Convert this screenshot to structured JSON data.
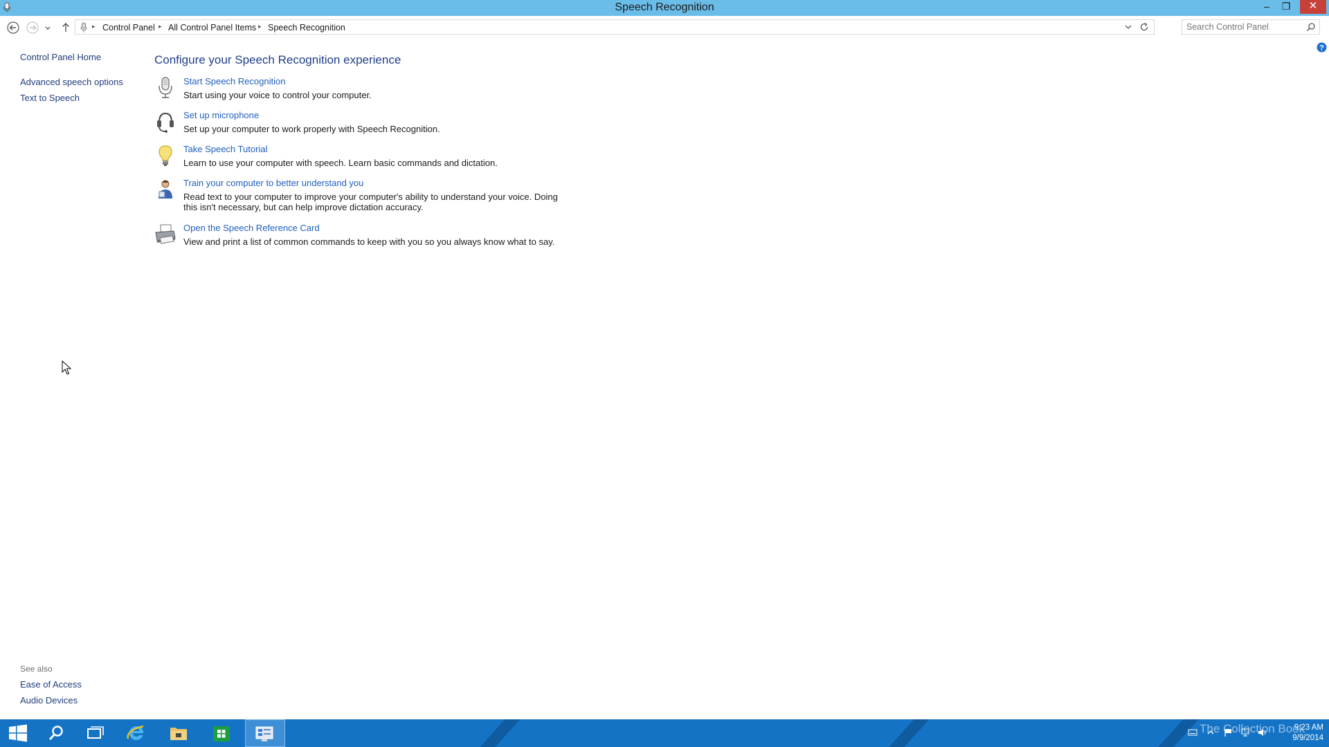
{
  "window": {
    "title": "Speech Recognition",
    "minimize_symbol": "–",
    "maximize_symbol": "❐",
    "close_symbol": "✕"
  },
  "address_bar": {
    "crumbs": [
      "Control Panel",
      "All Control Panel Items",
      "Speech Recognition"
    ],
    "separator": "▸"
  },
  "search": {
    "placeholder": "Search Control Panel"
  },
  "left_nav": {
    "home": "Control Panel Home",
    "items": [
      "Advanced speech options",
      "Text to Speech"
    ]
  },
  "see_also": {
    "label": "See also",
    "items": [
      "Ease of Access",
      "Audio Devices"
    ]
  },
  "main": {
    "heading": "Configure your Speech Recognition experience",
    "tasks": [
      {
        "icon": "microphone-icon",
        "link": "Start Speech Recognition",
        "desc": "Start using your voice to control your computer."
      },
      {
        "icon": "headset-icon",
        "link": "Set up microphone",
        "desc": "Set up your computer to work properly with Speech Recognition."
      },
      {
        "icon": "lightbulb-icon",
        "link": "Take Speech Tutorial",
        "desc": "Learn to use your computer with speech.  Learn basic commands and dictation."
      },
      {
        "icon": "user-train-icon",
        "link": "Train your computer to better understand you",
        "desc": "Read text to your computer to improve your computer's ability to understand your voice.  Doing this isn't necessary, but can help improve dictation accuracy."
      },
      {
        "icon": "printer-icon",
        "link": "Open the Speech Reference Card",
        "desc": "View and print a list of common commands to keep with you so you always know what to say."
      }
    ]
  },
  "taskbar": {
    "watermark": "The Collection Book",
    "time": "9:23 AM",
    "date": "9/9/2014",
    "colors": {
      "background": "#1573c5",
      "titlebar": "#6bbde9",
      "link": "#1e5fbe"
    }
  }
}
